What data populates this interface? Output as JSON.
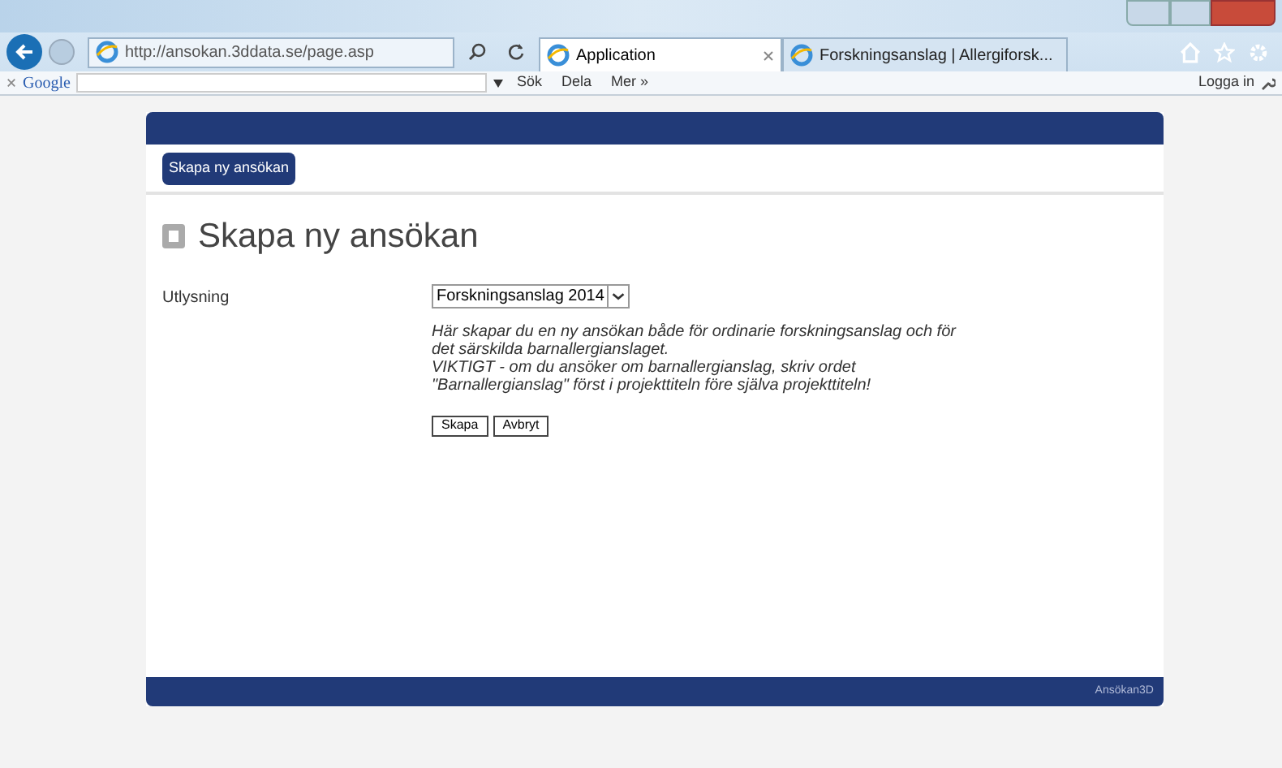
{
  "browser": {
    "address": "http://ansokan.3ddata.se/page.asp",
    "tabs": [
      {
        "title": "Application",
        "selected": true
      },
      {
        "title": "Forskningsanslag | Allergiforsk...",
        "selected": false
      }
    ],
    "toolbar": {
      "search_engine": "Google",
      "items": [
        "Sök",
        "Dela",
        "Mer »"
      ],
      "login": "Logga in"
    }
  },
  "page": {
    "nav_button": "Skapa ny ansökan",
    "heading": "Skapa ny ansökan",
    "form": {
      "label": "Utlysning",
      "select_value": "Forskningsanslag 2014",
      "description": [
        "Här skapar du en ny ansökan både för ordinarie forskningsanslag och för det särskilda barnallergianslaget.",
        "VIKTIGT - om du ansöker om barnallergianslag, skriv ordet \"Barnallergianslag\" först i projekttiteln före själva projekttiteln!"
      ],
      "buttons": [
        "Skapa",
        "Avbryt"
      ]
    },
    "footer": "Ansökan3D"
  }
}
